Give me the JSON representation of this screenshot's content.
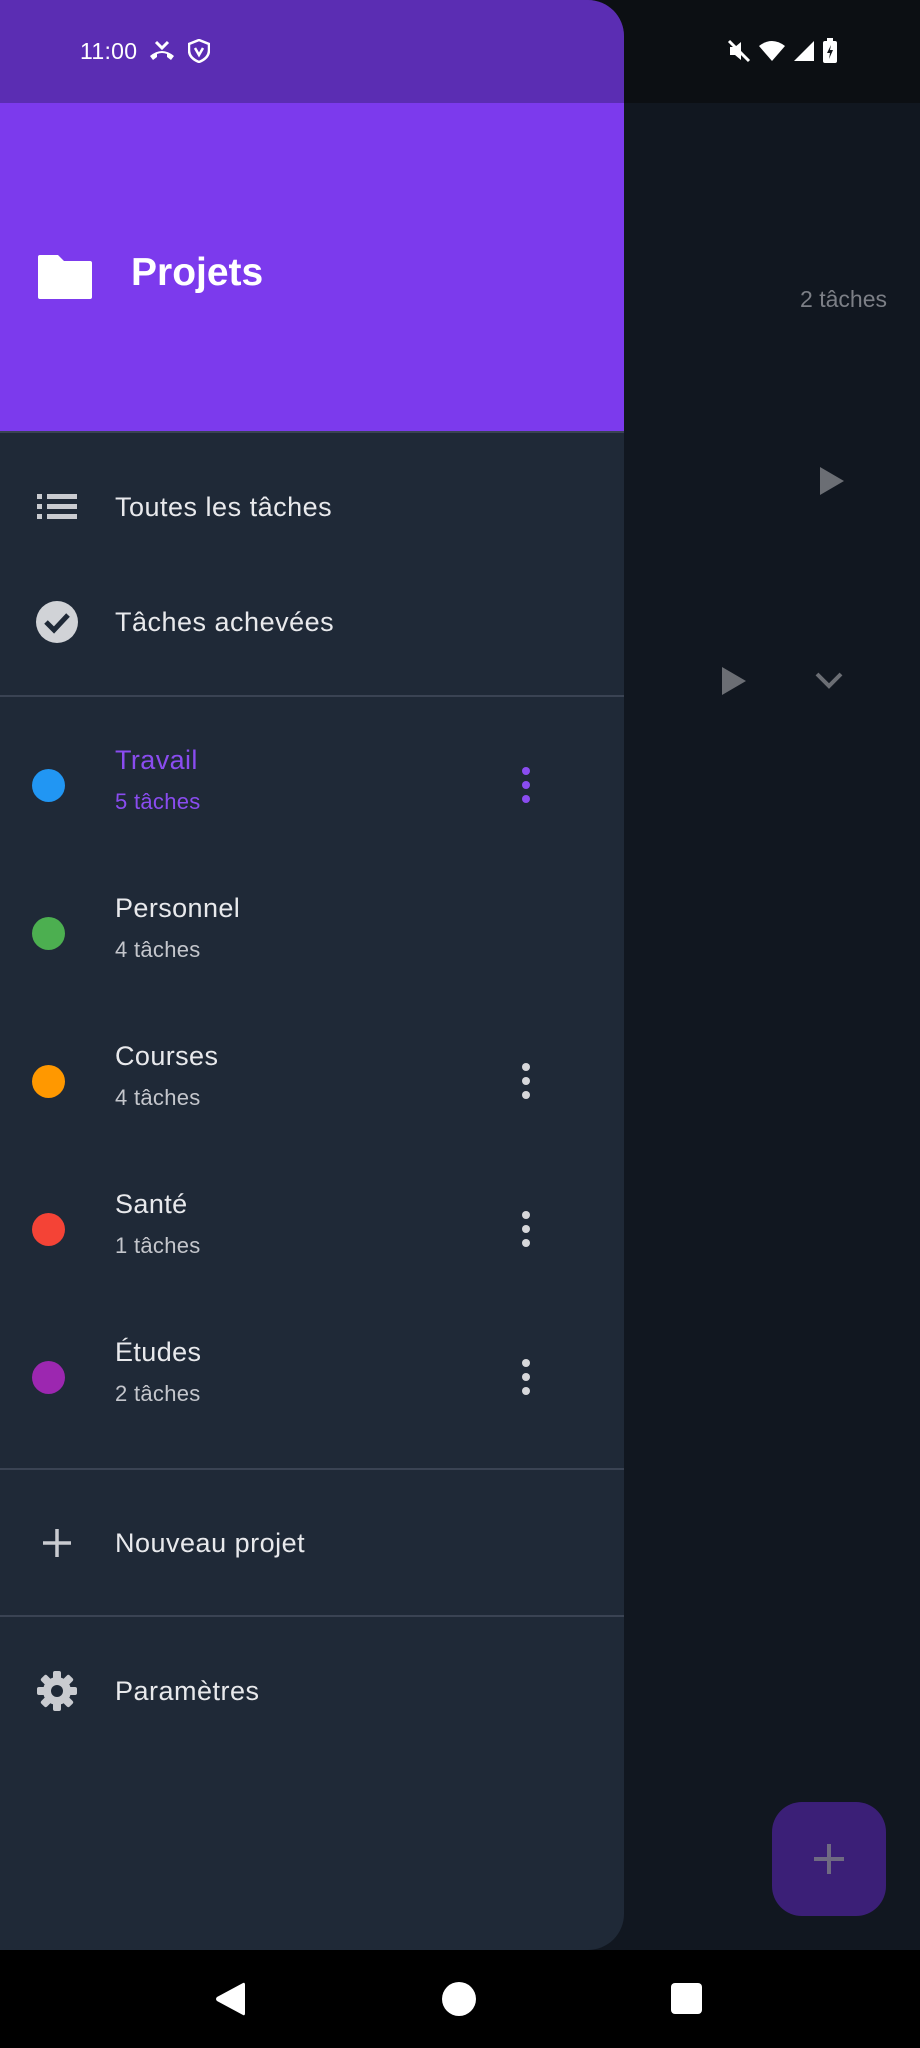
{
  "status_bar": {
    "time": "11:00"
  },
  "background": {
    "task_count": "2 tâches"
  },
  "drawer": {
    "title": "Projets",
    "nav": [
      {
        "label": "Toutes les tâches",
        "icon": "list-icon"
      },
      {
        "label": "Tâches achevées",
        "icon": "check-circle-icon"
      }
    ],
    "projects": [
      {
        "name": "Travail",
        "count": "5 tâches",
        "color": "#2196f3",
        "selected": true
      },
      {
        "name": "Personnel",
        "count": "4 tâches",
        "color": "#4caf50",
        "selected": false
      },
      {
        "name": "Courses",
        "count": "4 tâches",
        "color": "#ff9800",
        "selected": false
      },
      {
        "name": "Santé",
        "count": "1 tâches",
        "color": "#f44336",
        "selected": false
      },
      {
        "name": "Études",
        "count": "2 tâches",
        "color": "#9c27b0",
        "selected": false
      }
    ],
    "new_project_label": "Nouveau projet",
    "settings_label": "Paramètres"
  },
  "colors": {
    "accent": "#7c3aed",
    "selected_text": "#8a4cf0",
    "drawer_bg": "#1f2937"
  }
}
